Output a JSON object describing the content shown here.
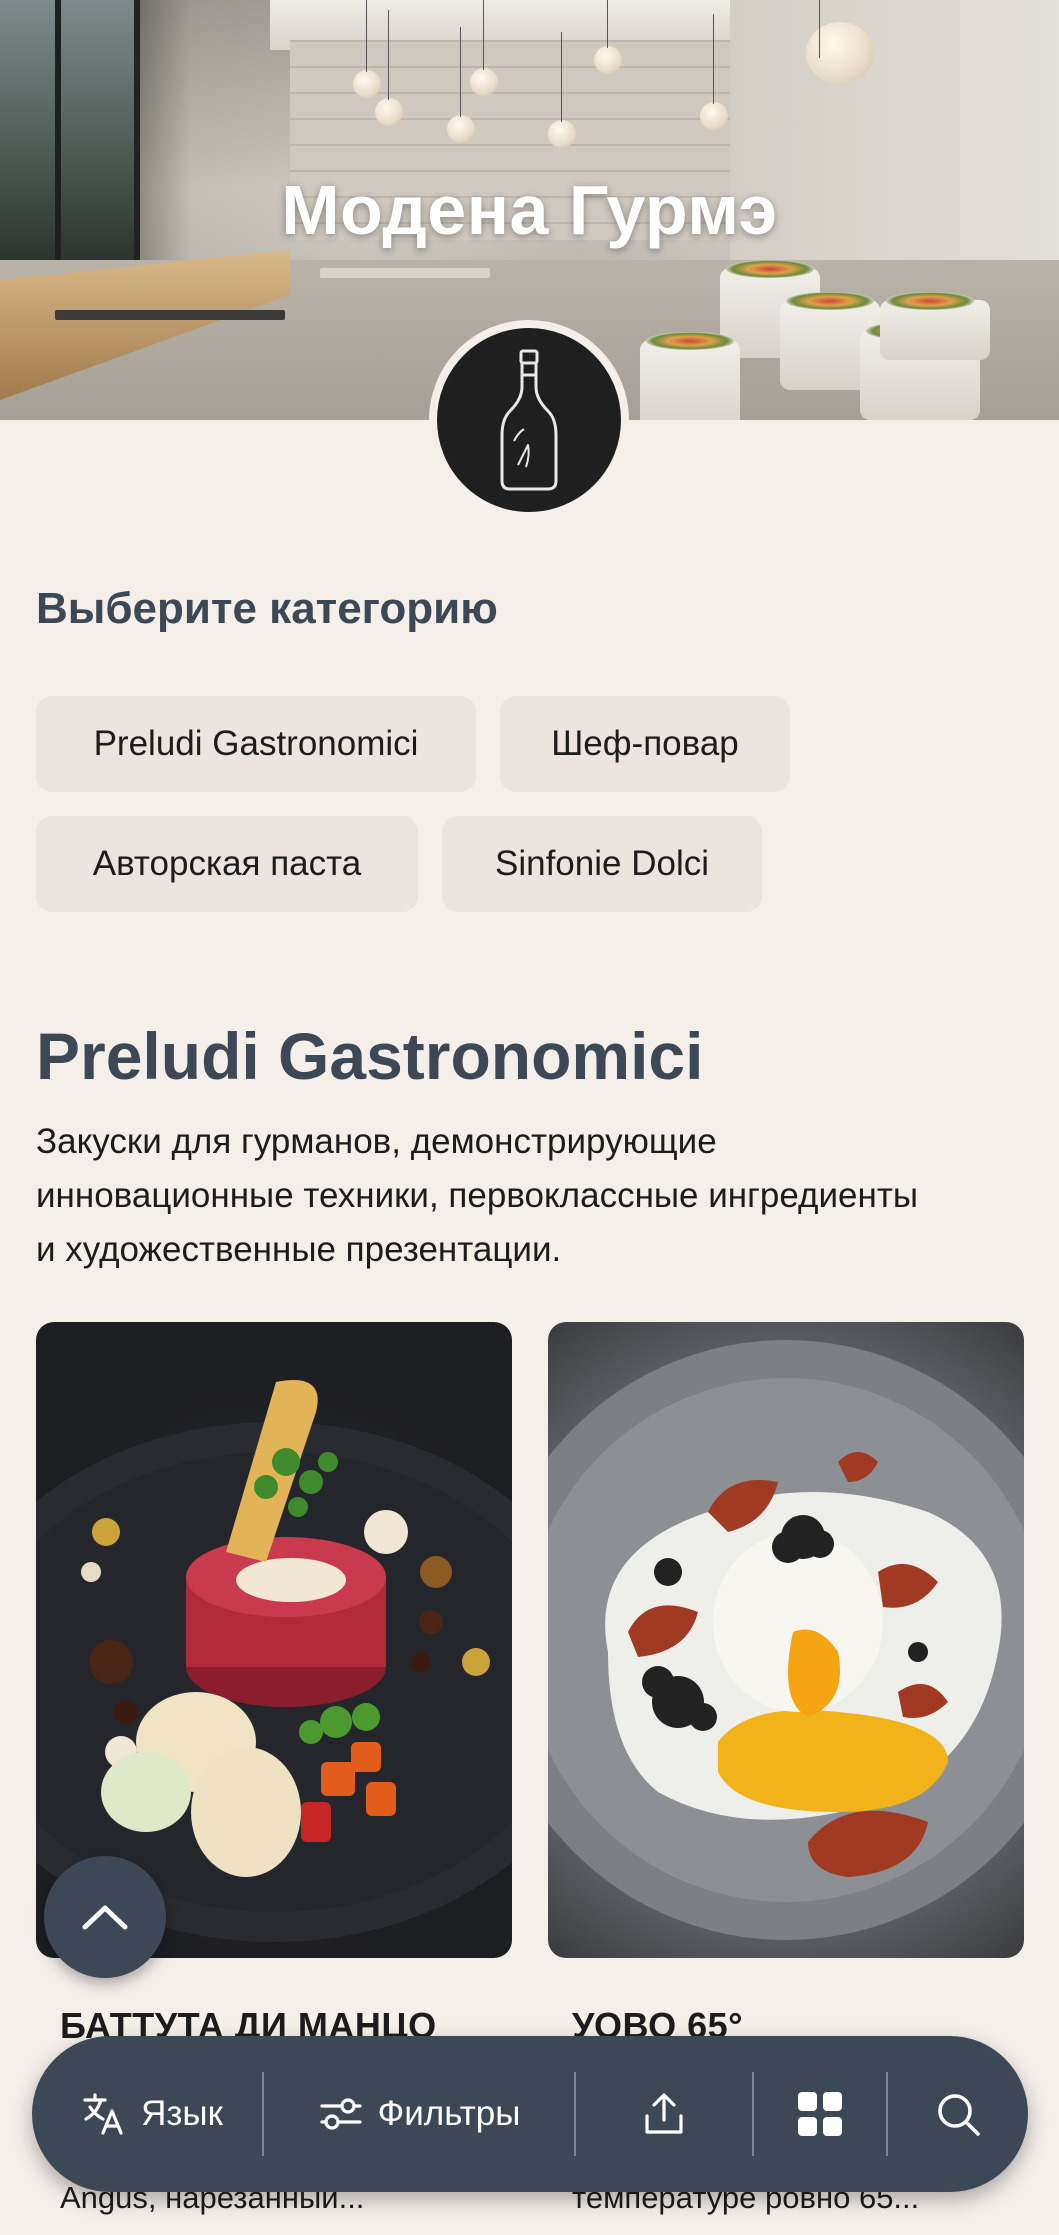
{
  "hero": {
    "title": "Модена Гурмэ",
    "logo_icon": "wine-bottle-icon"
  },
  "categories": {
    "heading": "Выберите категорию",
    "items": [
      {
        "label": "Preludi Gastronomici"
      },
      {
        "label": "Шеф-повар"
      },
      {
        "label": "Авторская паста"
      },
      {
        "label": "Sinfonie Dolci"
      }
    ]
  },
  "section": {
    "title": "Preludi Gastronomici",
    "description_lines": [
      "Закуски для гурманов, демонстрирующие",
      "инновационные техники, первоклассные ингредиенты",
      "и художественные презентации."
    ]
  },
  "dishes": [
    {
      "name": "БАТТУТА ДИ МАНЦО",
      "description": "Angus, нарезанный...",
      "image": "beef-tartare-plate"
    },
    {
      "name": "УОВО 65°",
      "description": "температуре ровно 65...",
      "image": "slow-cooked-egg-plate"
    }
  ],
  "bottom_bar": {
    "language_label": "Язык",
    "filters_label": "Фильтры",
    "icons": [
      "translate-icon",
      "filters-icon",
      "share-icon",
      "grid-icon",
      "search-icon"
    ]
  },
  "colors": {
    "background": "#f5efea",
    "accent": "#3c4856",
    "chip": "#ece4de"
  }
}
